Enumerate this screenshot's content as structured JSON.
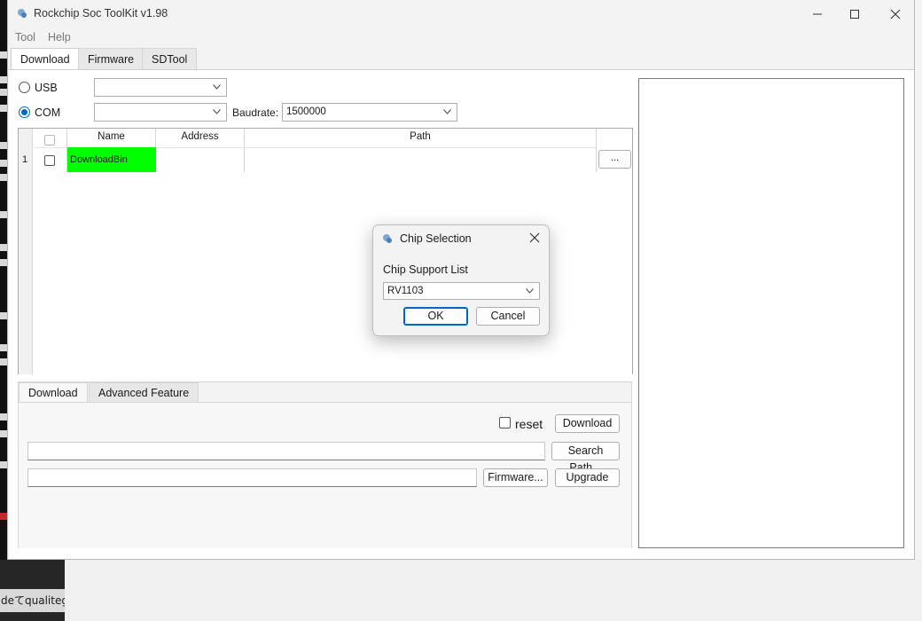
{
  "window": {
    "title": "Rockchip Soc ToolKit v1.98",
    "accent_color": "#0067c0",
    "highlight_color": "#00ff00"
  },
  "menu": [
    "Tool",
    "Help"
  ],
  "tabs": [
    "Download",
    "Firmware",
    "SDTool"
  ],
  "connection": {
    "usb_label": "USB",
    "com_label": "COM",
    "selected": "COM",
    "usb_device": "",
    "com_port": "",
    "baudrate_label": "Baudrate:",
    "baudrate_value": "1500000"
  },
  "grid": {
    "columns": [
      "Name",
      "Address",
      "Path"
    ],
    "rows": [
      {
        "index": "1",
        "name": "DownloadBin",
        "address": "",
        "path": "",
        "browse_label": "..."
      }
    ]
  },
  "lower_tabs": [
    "Download",
    "Advanced Feature"
  ],
  "download_panel": {
    "reset_label": "reset",
    "download_button": "Download",
    "search_path_value": "",
    "search_path_button": "Search Path...",
    "firmware_value": "",
    "firmware_button": "Firmware...",
    "upgrade_button": "Upgrade"
  },
  "dialog": {
    "title": "Chip Selection",
    "list_label": "Chip Support List",
    "selected_chip": "RV1103",
    "ok_label": "OK",
    "cancel_label": "Cancel"
  },
  "background": {
    "taskbar_text": "deてqualiteg-s"
  }
}
